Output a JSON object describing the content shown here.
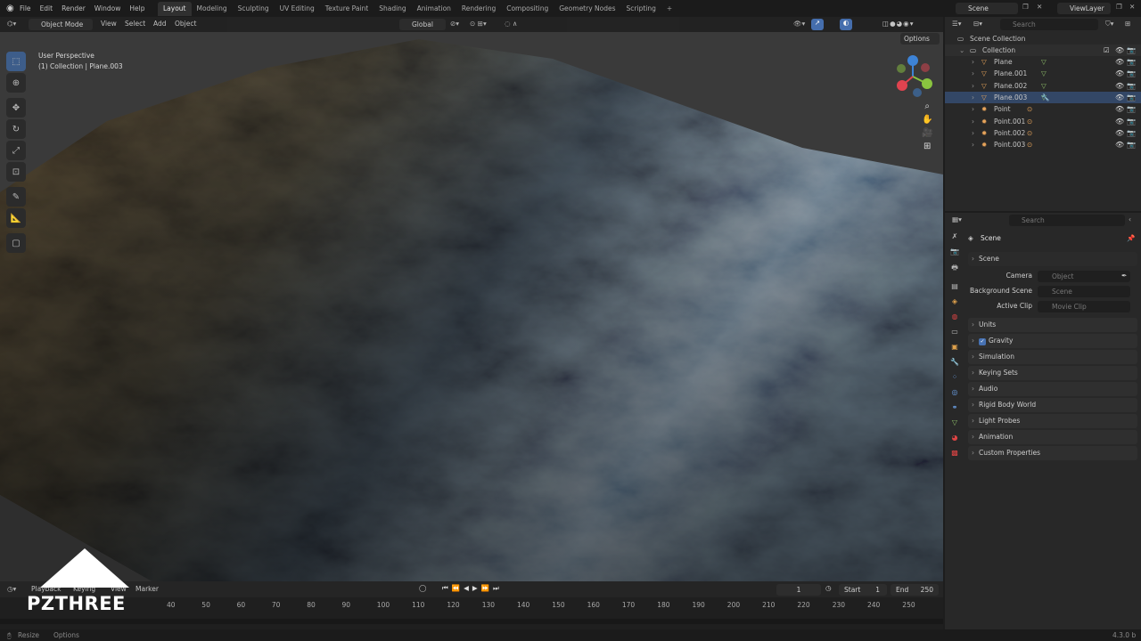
{
  "menu": [
    "File",
    "Edit",
    "Render",
    "Window",
    "Help"
  ],
  "workspaces": [
    "Layout",
    "Modeling",
    "Sculpting",
    "UV Editing",
    "Texture Paint",
    "Shading",
    "Animation",
    "Rendering",
    "Compositing",
    "Geometry Nodes",
    "Scripting"
  ],
  "active_workspace": "Layout",
  "scene_name": "Scene",
  "view_layer": "ViewLayer",
  "viewport_header": {
    "mode": "Object Mode",
    "items": [
      "View",
      "Select",
      "Add",
      "Object"
    ],
    "orientation": "Global",
    "options": "Options"
  },
  "overlay_text": {
    "line1": "User Perspective",
    "line2": "(1) Collection | Plane.003"
  },
  "outliner": {
    "search_placeholder": "Search",
    "root": "Scene Collection",
    "collection": "Collection",
    "items": [
      {
        "name": "Plane",
        "type": "mesh"
      },
      {
        "name": "Plane.001",
        "type": "mesh"
      },
      {
        "name": "Plane.002",
        "type": "mesh"
      },
      {
        "name": "Plane.003",
        "type": "mesh"
      },
      {
        "name": "Point",
        "type": "light"
      },
      {
        "name": "Point.001",
        "type": "light"
      },
      {
        "name": "Point.002",
        "type": "light"
      },
      {
        "name": "Point.003",
        "type": "light"
      }
    ]
  },
  "properties": {
    "search_placeholder": "Search",
    "title": "Scene",
    "section": "Scene",
    "camera_label": "Camera",
    "camera_placeholder": "Object",
    "background_label": "Background Scene",
    "background_placeholder": "Scene",
    "clip_label": "Active Clip",
    "clip_placeholder": "Movie Clip",
    "panels": [
      "Units",
      "Gravity",
      "Simulation",
      "Keying Sets",
      "Audio",
      "Rigid Body World",
      "Light Probes",
      "Animation",
      "Custom Properties"
    ],
    "gravity_checked": true
  },
  "timeline": {
    "menu": [
      "Playback",
      "Keying",
      "View",
      "Marker"
    ],
    "current_frame": "1",
    "start_label": "Start",
    "start": "1",
    "end_label": "End",
    "end": "250",
    "ticks": [
      "40",
      "50",
      "60",
      "70",
      "80",
      "90",
      "100",
      "110",
      "120",
      "130",
      "140",
      "150",
      "160",
      "170",
      "180",
      "190",
      "200",
      "210",
      "220",
      "230",
      "240",
      "250"
    ]
  },
  "status": {
    "left": "Resize",
    "options": "Options",
    "version": "4.3.0 b"
  },
  "watermark": "PZTHREE",
  "colors": {
    "accent": "#4772b3",
    "mesh": "#8fbf6a",
    "light": "#e6a35a",
    "axis_x": "#e0434f",
    "axis_y": "#8ac43f",
    "axis_z": "#3d83d6"
  }
}
